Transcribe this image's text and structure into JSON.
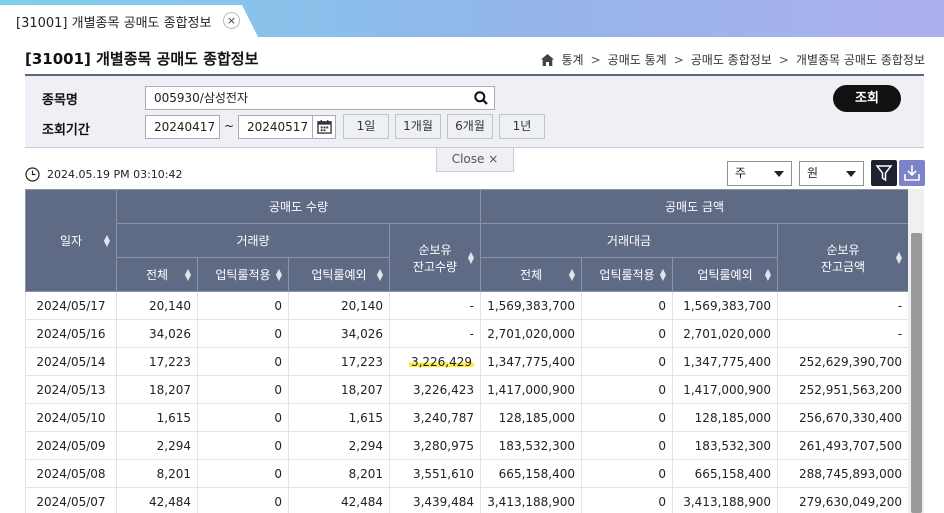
{
  "tab": {
    "title": "[31001] 개별종목 공매도 종합정보",
    "close_label": "×"
  },
  "page": {
    "title": "[31001] 개별종목 공매도 종합정보"
  },
  "breadcrumb": [
    "통계",
    "공매도 통계",
    "공매도 종합정보",
    "개별종목 공매도 종합정보"
  ],
  "search": {
    "stock_label": "종목명",
    "stock_value": "005930/삼성전자",
    "period_label": "조회기간",
    "date_from": "20240417",
    "date_sep": "~",
    "date_to": "20240517",
    "period_buttons": [
      "1일",
      "1개월",
      "6개월",
      "1년"
    ],
    "query_button": "조회",
    "close_label": "Close ×"
  },
  "toolbar": {
    "timestamp": "2024.05.19 PM 03:10:42",
    "unit_select": "주",
    "currency_select": "원"
  },
  "table": {
    "header_date": "일자",
    "group_qty": "공매도 수량",
    "group_amt": "공매도 금액",
    "sub_volume": "거래량",
    "sub_value": "거래대금",
    "qty_balance_line1": "순보유",
    "qty_balance_line2": "잔고수량",
    "amt_balance_line1": "순보유",
    "amt_balance_line2": "잔고금액",
    "col_total": "전체",
    "col_uptick_apply": "업틱룰적용",
    "col_uptick_except": "업틱룰예외",
    "rows": [
      [
        "2024/05/17",
        "20,140",
        "0",
        "20,140",
        "-",
        "1,569,383,700",
        "0",
        "1,569,383,700",
        "-"
      ],
      [
        "2024/05/16",
        "34,026",
        "0",
        "34,026",
        "-",
        "2,701,020,000",
        "0",
        "2,701,020,000",
        "-"
      ],
      [
        "2024/05/14",
        "17,223",
        "0",
        "17,223",
        "3,226,429",
        "1,347,775,400",
        "0",
        "1,347,775,400",
        "252,629,390,700"
      ],
      [
        "2024/05/13",
        "18,207",
        "0",
        "18,207",
        "3,226,423",
        "1,417,000,900",
        "0",
        "1,417,000,900",
        "252,951,563,200"
      ],
      [
        "2024/05/10",
        "1,615",
        "0",
        "1,615",
        "3,240,787",
        "128,185,000",
        "0",
        "128,185,000",
        "256,670,330,400"
      ],
      [
        "2024/05/09",
        "2,294",
        "0",
        "2,294",
        "3,280,975",
        "183,532,300",
        "0",
        "183,532,300",
        "261,493,707,500"
      ],
      [
        "2024/05/08",
        "8,201",
        "0",
        "8,201",
        "3,551,610",
        "665,158,400",
        "0",
        "665,158,400",
        "288,745,893,000"
      ],
      [
        "2024/05/07",
        "42,484",
        "0",
        "42,484",
        "3,439,484",
        "3,413,188,900",
        "0",
        "3,413,188,900",
        "279,630,049,200"
      ]
    ]
  },
  "colors": {
    "accent": "#5f6a84",
    "highlight": "#ffeb3b",
    "query_button": "#111111",
    "filter_button": "#7c83c8"
  },
  "icons": [
    "home-icon",
    "search-icon",
    "calendar-icon",
    "clock-icon",
    "filter-icon",
    "download-icon",
    "close-icon"
  ]
}
